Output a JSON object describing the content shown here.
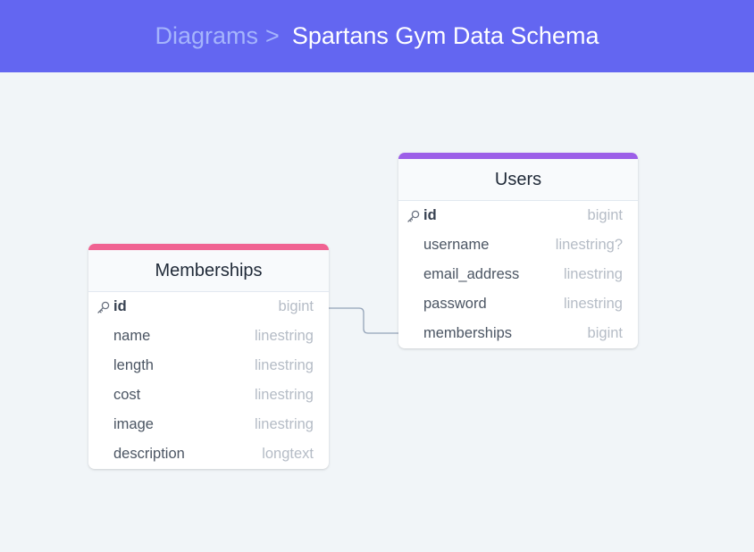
{
  "header": {
    "breadcrumb": "Diagrams",
    "separator": ">",
    "title": "Spartans Gym Data Schema"
  },
  "colors": {
    "header_bg": "#6366f1",
    "memberships_accent": "#f06292",
    "users_accent": "#9c5fe8",
    "connector": "#94a3b8"
  },
  "tables": {
    "memberships": {
      "name": "Memberships",
      "fields": [
        {
          "name": "id",
          "type": "bigint",
          "primary_key": true
        },
        {
          "name": "name",
          "type": "linestring"
        },
        {
          "name": "length",
          "type": "linestring"
        },
        {
          "name": "cost",
          "type": "linestring"
        },
        {
          "name": "image",
          "type": "linestring"
        },
        {
          "name": "description",
          "type": "longtext"
        }
      ]
    },
    "users": {
      "name": "Users",
      "fields": [
        {
          "name": "id",
          "type": "bigint",
          "primary_key": true
        },
        {
          "name": "username",
          "type": "linestring?"
        },
        {
          "name": "email_address",
          "type": "linestring"
        },
        {
          "name": "password",
          "type": "linestring"
        },
        {
          "name": "memberships",
          "type": "bigint"
        }
      ]
    }
  },
  "relations": [
    {
      "from": "memberships.id",
      "to": "users.memberships",
      "icon": "key-icon"
    }
  ]
}
